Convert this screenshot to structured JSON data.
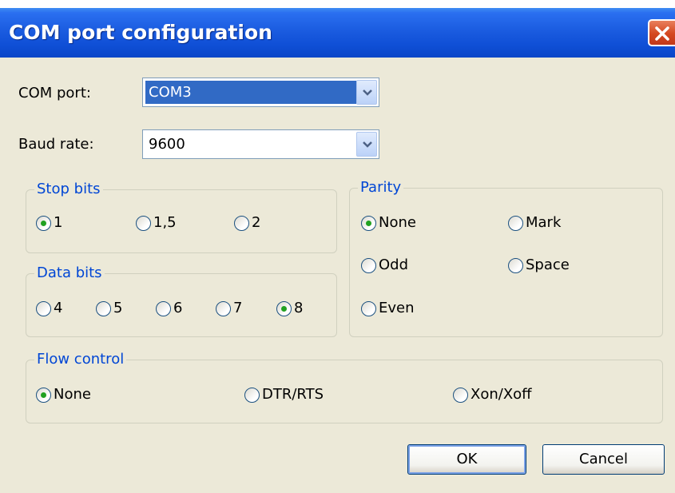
{
  "window": {
    "title": "COM port configuration"
  },
  "com_port": {
    "label": "COM port:",
    "value": "COM3"
  },
  "baud_rate": {
    "label": "Baud rate:",
    "value": "9600"
  },
  "stop_bits": {
    "legend": "Stop bits",
    "options": [
      {
        "label": "1",
        "checked": true
      },
      {
        "label": "1,5",
        "checked": false
      },
      {
        "label": "2",
        "checked": false
      }
    ]
  },
  "data_bits": {
    "legend": "Data bits",
    "options": [
      {
        "label": "4",
        "checked": false
      },
      {
        "label": "5",
        "checked": false
      },
      {
        "label": "6",
        "checked": false
      },
      {
        "label": "7",
        "checked": false
      },
      {
        "label": "8",
        "checked": true
      }
    ]
  },
  "parity": {
    "legend": "Parity",
    "options": [
      {
        "label": "None",
        "checked": true
      },
      {
        "label": "Mark",
        "checked": false
      },
      {
        "label": "Odd",
        "checked": false
      },
      {
        "label": "Space",
        "checked": false
      },
      {
        "label": "Even",
        "checked": false
      }
    ]
  },
  "flow_control": {
    "legend": "Flow control",
    "options": [
      {
        "label": "None",
        "checked": true
      },
      {
        "label": "DTR/RTS",
        "checked": false
      },
      {
        "label": "Xon/Xoff",
        "checked": false
      }
    ]
  },
  "buttons": {
    "ok": "OK",
    "cancel": "Cancel"
  },
  "icons": {
    "close": "close-icon",
    "dropdown": "chevron-down-icon"
  },
  "colors": {
    "accent": "#0046d5",
    "selection": "#316ac5",
    "radio_dot": "#21a121"
  }
}
